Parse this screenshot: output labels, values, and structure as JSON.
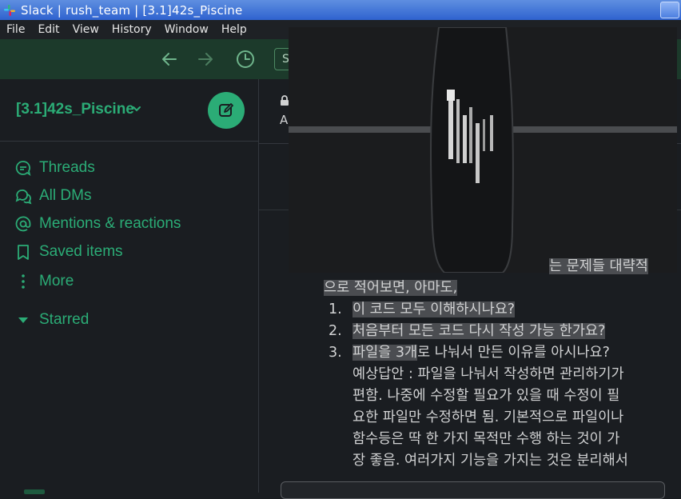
{
  "window": {
    "title": "Slack | rush_team | [3.1]42s_Piscine",
    "icon": "slack-icon"
  },
  "menu": [
    "File",
    "Edit",
    "View",
    "History",
    "Window",
    "Help"
  ],
  "toolbar": {
    "back_icon": "arrow-left-icon",
    "forward_icon": "arrow-right-icon",
    "history_icon": "clock-icon",
    "search_stub": "S"
  },
  "workspace": {
    "name": "[3.1]42s_Piscine",
    "compose_icon": "compose-icon"
  },
  "nav": [
    {
      "label": "Threads",
      "icon": "threads-icon"
    },
    {
      "label": "All DMs",
      "icon": "dms-icon"
    },
    {
      "label": "Mentions & reactions",
      "icon": "at-icon"
    },
    {
      "label": "Saved items",
      "icon": "bookmark-icon"
    },
    {
      "label": "More",
      "icon": "more-vertical-icon"
    },
    {
      "label": "Starred",
      "icon": "caret-down-icon"
    }
  ],
  "channel": {
    "lock_icon": "lock-icon",
    "topic_stub": "A"
  },
  "message": {
    "line1_tail": "는 문제들 대략적",
    "line2": "으로 적어보면, 아마도,",
    "items": [
      {
        "num": "1.",
        "text": "이 코드 모두 이해하시나요?"
      },
      {
        "num": "2.",
        "text": "처음부터 모든 코드 다시 작성 가능 한가요?"
      },
      {
        "num": "3.",
        "text_hl": "파일을 3개",
        "text_rest": "로 나눠서 만든 이유를 아시나요?"
      }
    ],
    "answer_lines": [
      "예상답안 : 파일을 나눠서 작성하면 관리하기가",
      "편함. 나중에 수정할 필요가 있을 때 수정이 필",
      "요한 파일만 수정하면 됨. 기본적으로 파일이나",
      "함수등은 딱 한 가지 목적만 수행 하는 것이 가",
      "장 좋음. 여러가지 기능을 가지는 것은 분리해서"
    ]
  },
  "colors": {
    "accent": "#2bac76",
    "titlebar": "#2e62cf",
    "toolbar": "#1c3a2b",
    "background": "#1a1d21",
    "highlight": "#4b4d51"
  }
}
